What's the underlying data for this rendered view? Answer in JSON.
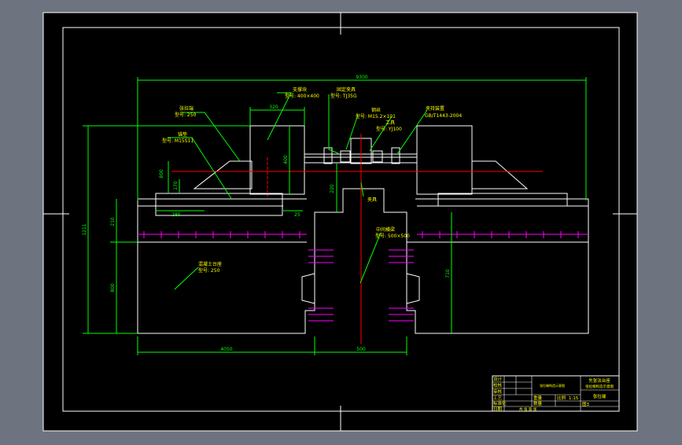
{
  "colors": {
    "background": "#6e7380",
    "paper": "#000000",
    "frame": "#ffffff",
    "dimension": "#00ff00",
    "text": "#ffff00",
    "centerline": "#ff0000",
    "rebar": "#ff00ff"
  },
  "dimensions": {
    "top_overall": "9300",
    "bearing_seat_width": "320",
    "bearing_seat_height": "400",
    "anchor_left": "800",
    "anchor_left_small": "170",
    "block_left": "285",
    "joint_gap": "25",
    "center_height": "220",
    "total_height": "1211",
    "left_height_upper": "210",
    "left_height_lower": "800",
    "right_height": "710",
    "bottom_left": "4050",
    "bottom_center": "500"
  },
  "labels": {
    "tensioner": "张拉端",
    "tensioner_model": "型号: 250",
    "support_block": "支撑块",
    "support_model": "型号: 400×400",
    "anchor": "锚垫",
    "anchor_model": "型号: M15S11",
    "fixture": "固定夹具",
    "fixture_model": "型号: TJ35G",
    "steel_strand": "钢丝",
    "steel_strand_model": "型号: M15.2×101",
    "tool": "工具",
    "tool_model": "型号: YJ100",
    "standard": "夹持装置",
    "standard_code": "GB/T1443-2004",
    "clamp": "夹具",
    "middle_beam": "中间横梁",
    "middle_beam_model": "型号: 500×500",
    "pedestal": "混凝土台座",
    "pedestal_model": "型号: 250"
  },
  "title_block": {
    "rows": [
      "设计",
      "校核",
      "审核",
      "工艺",
      "标准化",
      "日期"
    ],
    "drawing_name": "先张法台座",
    "drawing_sub": "张拉端构造示意图",
    "scale_label": "比例",
    "scale_value": "1:15",
    "sheet_code": "张拉端",
    "drawing_no": "图3",
    "weight_label": "重量",
    "footer": "共 张  第 张",
    "number_label": "数量",
    "designer_info": "张拉端构造示意图"
  }
}
